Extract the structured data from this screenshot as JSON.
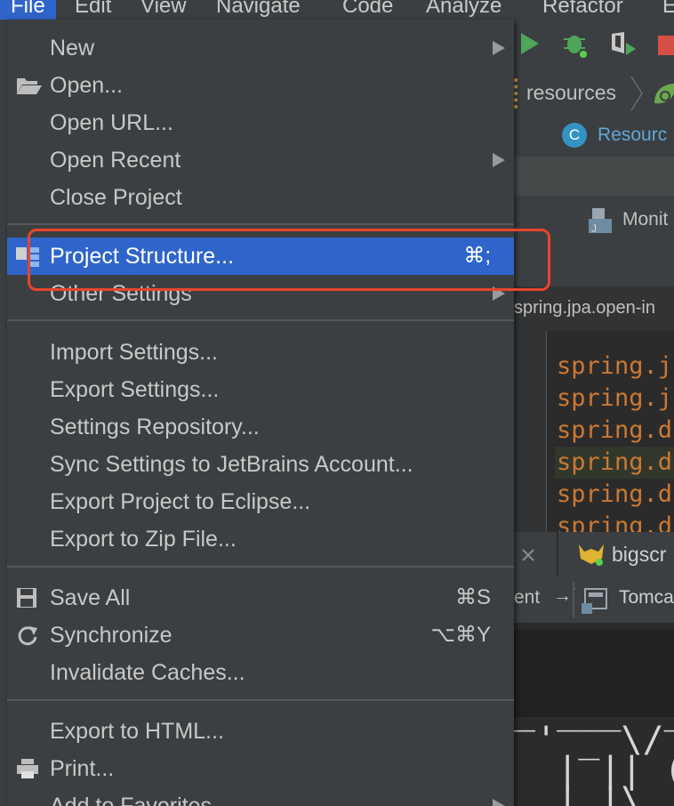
{
  "menubar": {
    "items": [
      "File",
      "Edit",
      "View",
      "Navigate",
      "Code",
      "Analyze",
      "Refactor",
      "E"
    ]
  },
  "background": {
    "breadcrumb": "resources",
    "editor_tab": "Resourc",
    "tool_tab": "Monit",
    "path_bar": "spring.jpa.open-in",
    "code_lines": [
      "spring.j",
      "spring.j",
      "spring.d",
      "spring.d",
      "spring.d",
      "spring.d"
    ],
    "run_tab": "bigscr",
    "run_left_text": "ent",
    "run_config": "Tomca",
    "ascii_art": [
      "_ ___  ___ _",
      " ' _ \\/ _` ",
      "  | || (_| ",
      "  | |\\ "
    ]
  },
  "file_menu": {
    "group1": [
      {
        "label": "New",
        "submenu": true
      },
      {
        "label": "Open...",
        "icon": "folder-open-icon"
      },
      {
        "label": "Open URL..."
      },
      {
        "label": "Open Recent",
        "submenu": true
      },
      {
        "label": "Close Project"
      }
    ],
    "group2": [
      {
        "label": "Project Structure...",
        "shortcut": "⌘;",
        "icon": "project-structure-icon",
        "selected": true
      },
      {
        "label": "Other Settings",
        "submenu": true
      }
    ],
    "group3": [
      {
        "label": "Import Settings..."
      },
      {
        "label": "Export Settings..."
      },
      {
        "label": "Settings Repository..."
      },
      {
        "label": "Sync Settings to JetBrains Account..."
      },
      {
        "label": "Export Project to Eclipse..."
      },
      {
        "label": "Export to Zip File..."
      }
    ],
    "group4": [
      {
        "label": "Save All",
        "shortcut": "⌘S",
        "icon": "save-icon"
      },
      {
        "label": "Synchronize",
        "shortcut": "⌥⌘Y",
        "icon": "sync-icon"
      },
      {
        "label": "Invalidate Caches..."
      }
    ],
    "group5": [
      {
        "label": "Export to HTML..."
      },
      {
        "label": "Print...",
        "icon": "print-icon"
      },
      {
        "label": "Add to Favorites",
        "submenu": true
      }
    ]
  },
  "highlight_color": "#e8452c",
  "selection_color": "#2f65ca"
}
